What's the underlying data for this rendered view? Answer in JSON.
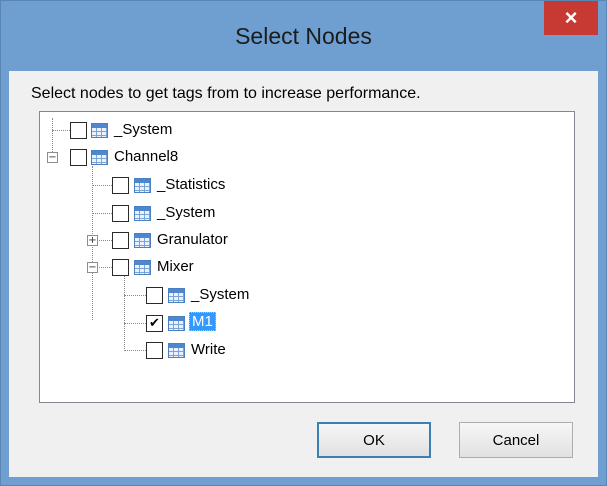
{
  "window": {
    "title": "Select Nodes",
    "close_symbol": "×"
  },
  "instruction": "Select nodes to get tags from to increase performance.",
  "tree": {
    "nodes": [
      {
        "label": "_System",
        "checked": false,
        "expander": null
      },
      {
        "label": "Channel8",
        "checked": false,
        "expander": "⊟"
      },
      {
        "label": "_Statistics",
        "checked": false,
        "expander": null
      },
      {
        "label": "_System",
        "checked": false,
        "expander": null
      },
      {
        "label": "Granulator",
        "checked": false,
        "expander": "⊞"
      },
      {
        "label": "Mixer",
        "checked": false,
        "expander": "⊟"
      },
      {
        "label": "_System",
        "checked": false,
        "expander": null
      },
      {
        "label": "M1",
        "checked": true,
        "expander": null,
        "selected": true
      },
      {
        "label": "Write",
        "checked": false,
        "expander": null
      }
    ],
    "check_mark": "✔",
    "minus": "−",
    "plus": "+"
  },
  "buttons": {
    "ok": "OK",
    "cancel": "Cancel"
  },
  "icons": {
    "node": "tag-table-icon",
    "close": "close-icon"
  }
}
